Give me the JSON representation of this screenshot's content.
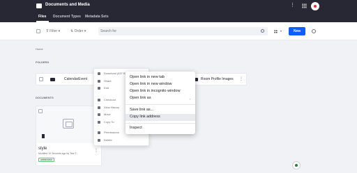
{
  "header": {
    "title": "Documents and Media"
  },
  "tabs": [
    {
      "label": "Files"
    },
    {
      "label": "Document Types"
    },
    {
      "label": "Metadata Sets"
    }
  ],
  "toolbar": {
    "filter_label": "Filter",
    "order_label": "Order",
    "search_placeholder": "Search for",
    "new_label": "New"
  },
  "breadcrumb": "Home",
  "sections": {
    "folders": "FOLDERS",
    "documents": "DOCUMENTS"
  },
  "folders": [
    {
      "name": "CalendarEvent"
    },
    {
      "name": "Room Profile Images"
    }
  ],
  "document": {
    "title": "style",
    "meta": "Modified 19 Seconds ago by Test T...",
    "status": "APPROVED"
  },
  "actions_menu": {
    "items": [
      {
        "label": "Download (837 B)"
      },
      {
        "label": "Share"
      },
      {
        "label": "Edit"
      },
      {
        "label": "Checkout"
      },
      {
        "label": "View History"
      },
      {
        "label": "Move"
      },
      {
        "label": "Copy To"
      },
      {
        "label": "Permissions"
      },
      {
        "label": "Delete"
      }
    ]
  },
  "context_menu": {
    "items": [
      {
        "label": "Open link in new tab"
      },
      {
        "label": "Open link in new window"
      },
      {
        "label": "Open link in incognito window"
      },
      {
        "label": "Open link as"
      },
      {
        "label": "Save link as..."
      },
      {
        "label": "Copy link address"
      },
      {
        "label": "Inspect"
      }
    ]
  },
  "colors": {
    "brand": "#0b5fff",
    "topbar": "#272833",
    "approved": "#287d3c"
  }
}
